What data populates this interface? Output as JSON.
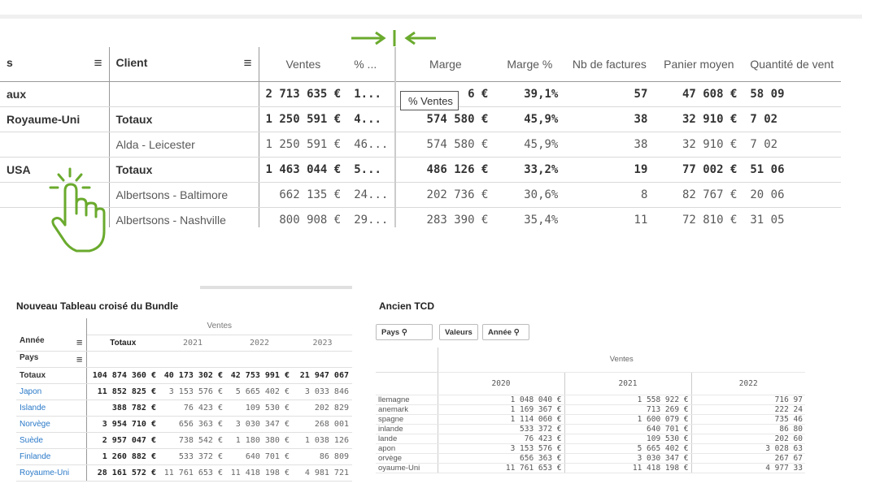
{
  "top_table": {
    "columns": [
      "s",
      "Client",
      "Ventes",
      "% ...",
      "Marge",
      "Marge %",
      "Nb de factures",
      "Panier moyen",
      "Quantité de vent"
    ],
    "rows": [
      {
        "kind": "total",
        "cells": [
          "aux",
          "",
          "2 713 635 €",
          "1...",
          "",
          "39,1%",
          "57",
          "47 608 €",
          "58 09"
        ],
        "marge_suffix": "6 €"
      },
      {
        "kind": "total",
        "country": "Royaume-Uni",
        "cells": [
          "Royaume-Uni",
          "Totaux",
          "1 250 591 €",
          "4...",
          "574 580 €",
          "45,9%",
          "38",
          "32 910 €",
          "7 02"
        ]
      },
      {
        "kind": "row",
        "cells": [
          "",
          "Alda - Leicester",
          "1 250 591 €",
          "46...",
          "574 580 €",
          "45,9%",
          "38",
          "32 910 €",
          "7 02"
        ]
      },
      {
        "kind": "total",
        "country": "USA",
        "cells": [
          "USA",
          "Totaux",
          "1 463 044 €",
          "5...",
          "486 126 €",
          "33,2%",
          "19",
          "77 002 €",
          "51 06"
        ]
      },
      {
        "kind": "row",
        "cells": [
          "",
          "Albertsons - Baltimore",
          "662 135 €",
          "24...",
          "202 736 €",
          "30,6%",
          "8",
          "82 767 €",
          "20 06"
        ]
      },
      {
        "kind": "row",
        "cells": [
          "",
          "Albertsons - Nashville",
          "800 908 €",
          "29...",
          "283 390 €",
          "35,4%",
          "11",
          "72 810 €",
          "31 05"
        ]
      }
    ],
    "tooltip": "% Ventes"
  },
  "new_pivot": {
    "title": "Nouveau Tableau croisé du Bundle",
    "measure": "Ventes",
    "dim_annee": "Année",
    "dim_pays": "Pays",
    "years_header": [
      "Totaux",
      "2021",
      "2022",
      "2023"
    ],
    "rows": [
      {
        "label": "Totaux",
        "vals": [
          "104 874 360 €",
          "40 173 302 €",
          "42 753 991 €",
          "21 947 067"
        ],
        "total": true
      },
      {
        "label": "Japon",
        "vals": [
          "11 852 825 €",
          "3 153 576 €",
          "5 665 402 €",
          "3 033 846"
        ]
      },
      {
        "label": "Islande",
        "vals": [
          "388 782 €",
          "76 423 €",
          "109 530 €",
          "202 829"
        ]
      },
      {
        "label": "Norvège",
        "vals": [
          "3 954 710 €",
          "656 363 €",
          "3 030 347 €",
          "268 001"
        ]
      },
      {
        "label": "Suède",
        "vals": [
          "2 957 047 €",
          "738 542 €",
          "1 180 380 €",
          "1 038 126"
        ]
      },
      {
        "label": "Finlande",
        "vals": [
          "1 260 882 €",
          "533 372 €",
          "640 701 €",
          "86 809"
        ]
      },
      {
        "label": "Royaume-Uni",
        "vals": [
          "28 161 572 €",
          "11 761 653 €",
          "11 418 198 €",
          "4 981 721"
        ]
      }
    ]
  },
  "old_pivot": {
    "title": "Ancien TCD",
    "chip_pays": "Pays",
    "chip_valeurs": "Valeurs",
    "chip_annee": "Année",
    "measure": "Ventes",
    "years": [
      "2020",
      "2021",
      "2022"
    ],
    "rows": [
      {
        "label": "llemagne",
        "vals": [
          "1 048 040 €",
          "1 558 922 €",
          "716 97"
        ]
      },
      {
        "label": "anemark",
        "vals": [
          "1 169 367 €",
          "713 269 €",
          "222 24"
        ]
      },
      {
        "label": "spagne",
        "vals": [
          "1 114 060 €",
          "1 600 079 €",
          "735 46"
        ]
      },
      {
        "label": "inlande",
        "vals": [
          "533 372 €",
          "640 701 €",
          "86 80"
        ]
      },
      {
        "label": "lande",
        "vals": [
          "76 423 €",
          "109 530 €",
          "202 60"
        ]
      },
      {
        "label": "apon",
        "vals": [
          "3 153 576 €",
          "5 665 402 €",
          "3 028 63"
        ]
      },
      {
        "label": "orvège",
        "vals": [
          "656 363 €",
          "3 030 347 €",
          "267 67"
        ]
      },
      {
        "label": "oyaume-Uni",
        "vals": [
          "11 761 653 €",
          "11 418 198 €",
          "4 977 33"
        ]
      }
    ]
  },
  "colors": {
    "accent_green": "#6aaa2d",
    "link_blue": "#2a79c8"
  }
}
